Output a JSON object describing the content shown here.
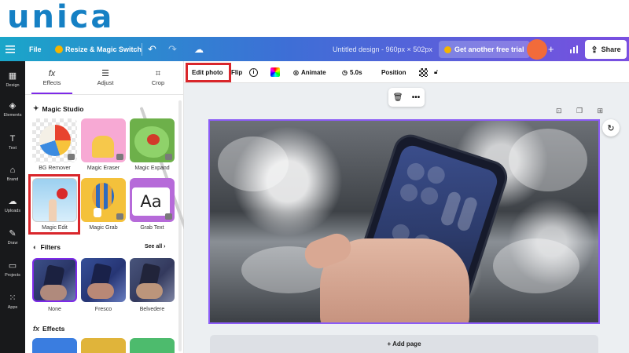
{
  "logo": {
    "text": "unica",
    "color": "#1580c4"
  },
  "topbar": {
    "menu_icon": "hamburger-icon",
    "file_label": "File",
    "resize_label": "Resize & Magic Switch",
    "undo_icon": "undo-icon",
    "redo_icon": "redo-icon",
    "cloud_icon": "cloud-save-icon",
    "design_title": "Untitled design - 960px × 502px",
    "trial_label": "Get another free trial",
    "plus_icon": "plus-icon",
    "stats_icon": "bar-chart-icon",
    "share_label": "Share"
  },
  "rail": {
    "items": [
      {
        "label": "Design",
        "icon": "layout-icon"
      },
      {
        "label": "Elements",
        "icon": "shapes-icon"
      },
      {
        "label": "Text",
        "icon": "text-icon"
      },
      {
        "label": "Brand",
        "icon": "brand-icon"
      },
      {
        "label": "Uploads",
        "icon": "upload-cloud-icon"
      },
      {
        "label": "Draw",
        "icon": "pen-icon"
      },
      {
        "label": "Projects",
        "icon": "folder-icon"
      },
      {
        "label": "Apps",
        "icon": "grid-icon"
      }
    ]
  },
  "panel": {
    "tabs": [
      {
        "label": "Effects",
        "icon": "fx-icon",
        "active": true
      },
      {
        "label": "Adjust",
        "icon": "sliders-icon"
      },
      {
        "label": "Crop",
        "icon": "crop-icon"
      }
    ],
    "magic_studio": {
      "title": "Magic Studio",
      "tools": [
        {
          "label": "BG Remover"
        },
        {
          "label": "Magic Eraser"
        },
        {
          "label": "Magic Expand"
        },
        {
          "label": "Magic Edit",
          "highlighted": true
        },
        {
          "label": "Magic Grab"
        },
        {
          "label": "Grab Text"
        }
      ]
    },
    "filters": {
      "title": "Filters",
      "see_all": "See all",
      "items": [
        {
          "label": "None",
          "selected": true
        },
        {
          "label": "Fresco"
        },
        {
          "label": "Belvedere"
        }
      ]
    },
    "effects": {
      "title": "Effects"
    }
  },
  "context_toolbar": {
    "edit_photo": "Edit photo",
    "flip": "Flip",
    "animate": "Animate",
    "duration": "5.0s",
    "position": "Position"
  },
  "canvas": {
    "add_page": "+ Add page"
  },
  "colors": {
    "accent": "#7d2ae8",
    "highlight_box": "#d9262b",
    "selection_border": "#8b5cf6",
    "avatar": "#f26b3a"
  }
}
